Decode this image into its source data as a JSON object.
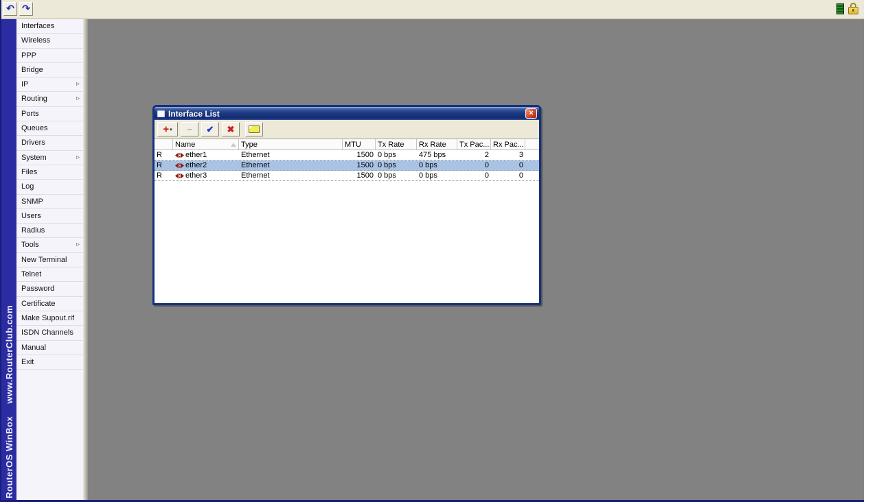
{
  "topbar": {
    "undo_glyph": "↶",
    "redo_glyph": "↷",
    "status_icons": [
      "connection-quality-icon",
      "secure-session-padlock-icon"
    ]
  },
  "sidebar": {
    "brand_line1": "RouterOS WinBox",
    "brand_line2": "www.RouterClub.com",
    "submenu_arrow": "▹",
    "items": [
      {
        "label": "Interfaces",
        "has_submenu": false
      },
      {
        "label": "Wireless",
        "has_submenu": false
      },
      {
        "label": "PPP",
        "has_submenu": false
      },
      {
        "label": "Bridge",
        "has_submenu": false
      },
      {
        "label": "IP",
        "has_submenu": true
      },
      {
        "label": "Routing",
        "has_submenu": true
      },
      {
        "label": "Ports",
        "has_submenu": false
      },
      {
        "label": "Queues",
        "has_submenu": false
      },
      {
        "label": "Drivers",
        "has_submenu": false
      },
      {
        "label": "System",
        "has_submenu": true
      },
      {
        "label": "Files",
        "has_submenu": false
      },
      {
        "label": "Log",
        "has_submenu": false
      },
      {
        "label": "SNMP",
        "has_submenu": false
      },
      {
        "label": "Users",
        "has_submenu": false
      },
      {
        "label": "Radius",
        "has_submenu": false
      },
      {
        "label": "Tools",
        "has_submenu": true
      },
      {
        "label": "New Terminal",
        "has_submenu": false
      },
      {
        "label": "Telnet",
        "has_submenu": false
      },
      {
        "label": "Password",
        "has_submenu": false
      },
      {
        "label": "Certificate",
        "has_submenu": false
      },
      {
        "label": "Make Supout.rif",
        "has_submenu": false
      },
      {
        "label": "ISDN Channels",
        "has_submenu": false
      },
      {
        "label": "Manual",
        "has_submenu": false
      },
      {
        "label": "Exit",
        "has_submenu": false
      }
    ]
  },
  "window": {
    "title": "Interface List",
    "close_glyph": "×",
    "toolbar": {
      "add_glyph": "+",
      "dropdown_glyph": "▾",
      "remove_glyph": "−",
      "enable_glyph": "✔",
      "disable_glyph": "✖",
      "comment_icon": "yellow-note-icon"
    },
    "table": {
      "columns": {
        "flag": "",
        "name": "Name",
        "type": "Type",
        "mtu": "MTU",
        "tx_rate": "Tx Rate",
        "rx_rate": "Rx Rate",
        "tx_pac": "Tx Pac...",
        "rx_pac": "Rx Pac..."
      },
      "rows": [
        {
          "flag": "R",
          "name": "ether1",
          "type": "Ethernet",
          "mtu": "1500",
          "tx_rate": "0 bps",
          "rx_rate": "475 bps",
          "tx_pac": "2",
          "rx_pac": "3",
          "selected": false
        },
        {
          "flag": "R",
          "name": "ether2",
          "type": "Ethernet",
          "mtu": "1500",
          "tx_rate": "0 bps",
          "rx_rate": "0 bps",
          "tx_pac": "0",
          "rx_pac": "0",
          "selected": true
        },
        {
          "flag": "R",
          "name": "ether3",
          "type": "Ethernet",
          "mtu": "1500",
          "tx_rate": "0 bps",
          "rx_rate": "0 bps",
          "tx_pac": "0",
          "rx_pac": "0",
          "selected": false
        }
      ]
    }
  },
  "colors": {
    "brand_strip": "#2b2ba2",
    "desktop": "#828282",
    "titlebar_blue": "#1e3e85",
    "selected_row": "#a9c3e5",
    "add_accent": "#cc1111",
    "enable_accent": "#2233cc",
    "close_red": "#d9532f"
  }
}
